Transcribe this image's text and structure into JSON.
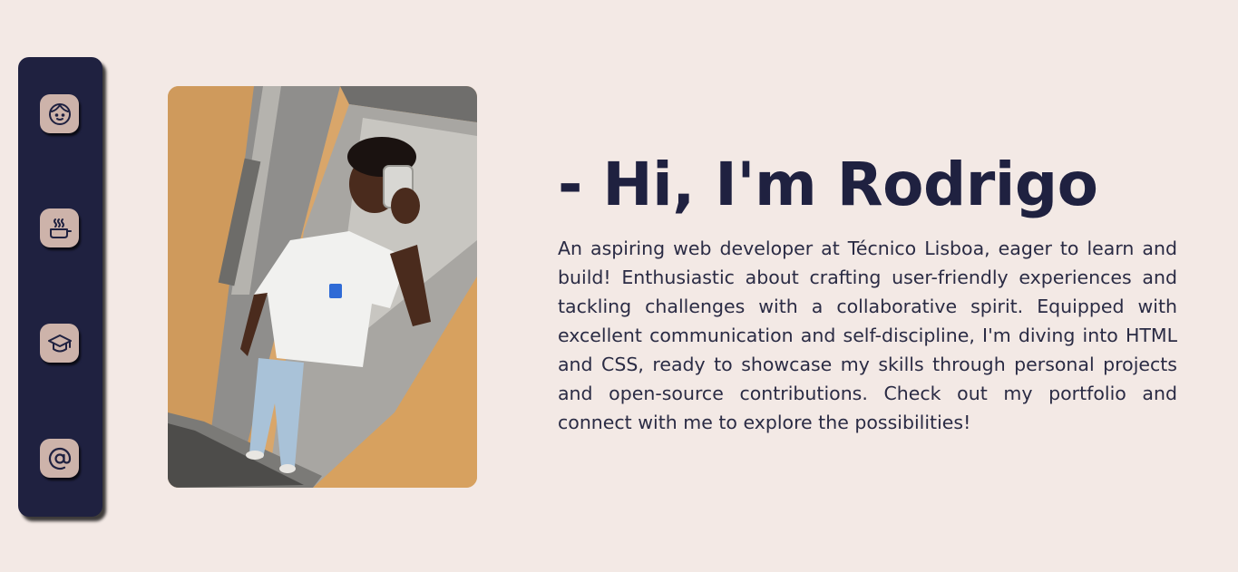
{
  "sidebar": {
    "items": [
      {
        "icon": "face-icon",
        "label": ""
      },
      {
        "icon": "cooking-pot-icon",
        "label": ""
      },
      {
        "icon": "graduation-cap-icon",
        "label": ""
      },
      {
        "icon": "at-sign-icon",
        "label": ""
      }
    ]
  },
  "hero": {
    "title": "- Hi, I'm Rodrigo",
    "bio": "An aspiring web developer at Técnico Lisboa, eager to learn and build! Enthusiastic about crafting user-friendly experiences and tackling challenges with a collaborative spirit. Equipped with excellent communication and self-discipline, I'm diving into HTML and CSS, ready to showcase my skills through personal projects and open-source contributions. Check out my portfolio and connect with me to explore the possibilities!"
  },
  "colors": {
    "background": "#f3e9e5",
    "sidebar": "#1f2140",
    "button": "#cdb3aa",
    "text": "#1f2140"
  }
}
